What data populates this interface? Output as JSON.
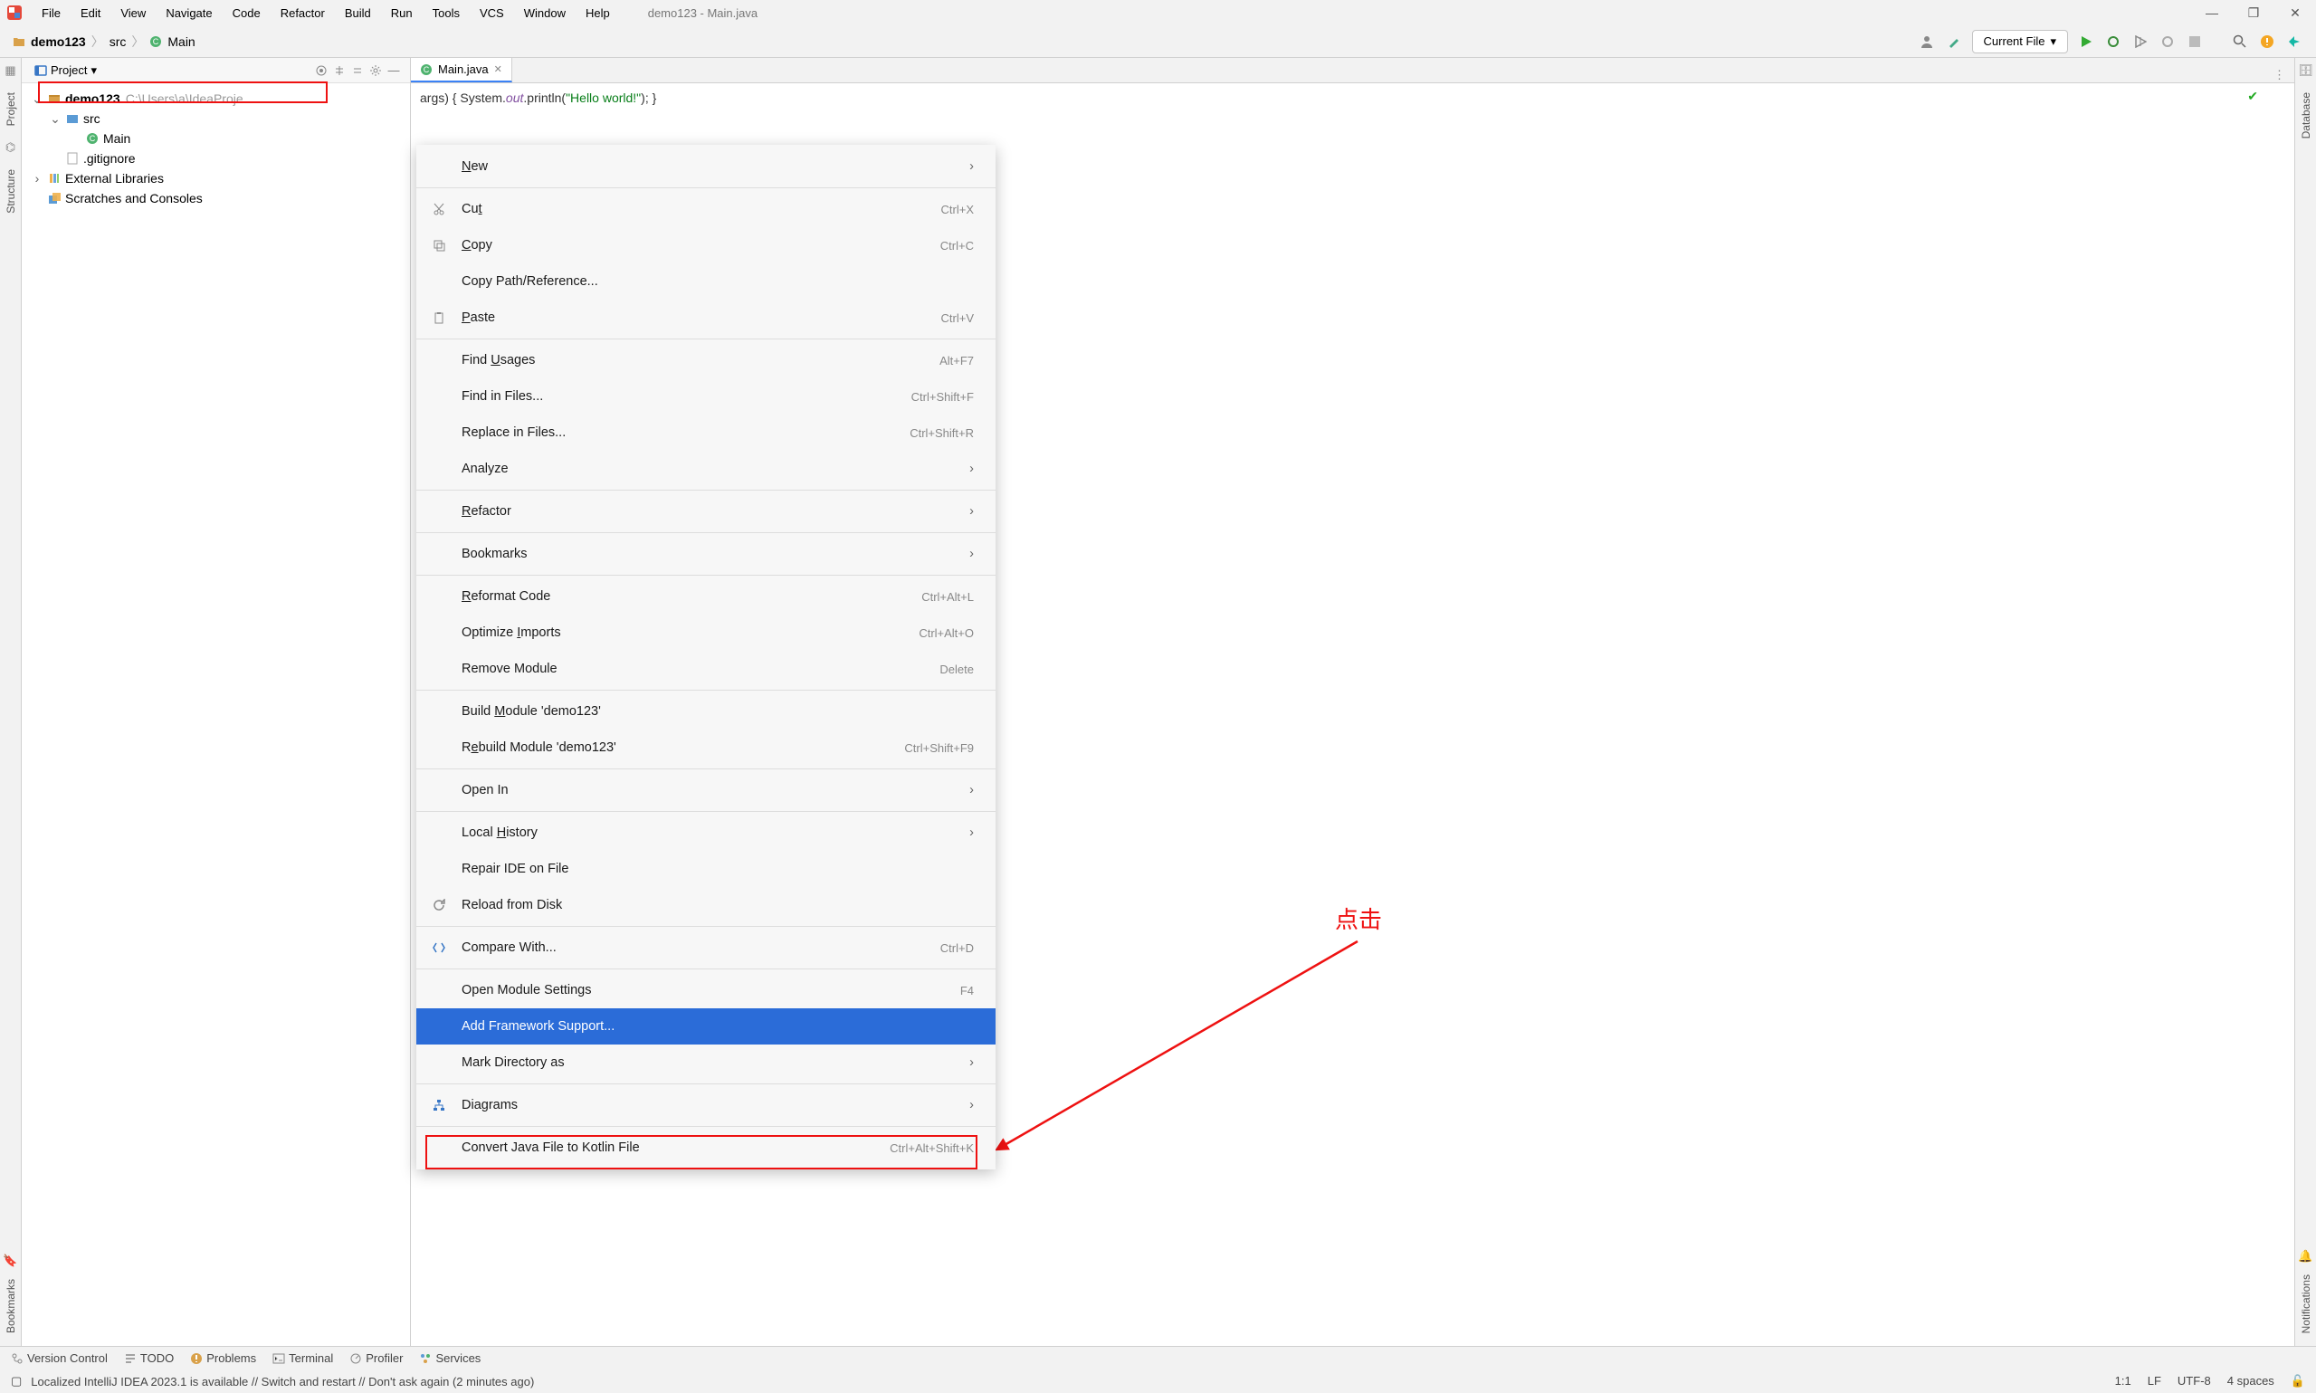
{
  "window": {
    "title": "demo123 - Main.java"
  },
  "menubar": [
    "File",
    "Edit",
    "View",
    "Navigate",
    "Code",
    "Refactor",
    "Build",
    "Run",
    "Tools",
    "VCS",
    "Window",
    "Help"
  ],
  "breadcrumb": {
    "project": "demo123",
    "folder": "src",
    "file": "Main"
  },
  "navbar": {
    "run_config": "Current File"
  },
  "project_panel": {
    "title": "Project",
    "root": {
      "name": "demo123",
      "path": "C:\\Users\\a\\IdeaProje"
    },
    "src": "src",
    "main": "Main",
    "gitignore": ".gitignore",
    "external": "External Libraries",
    "scratches": "Scratches and Consoles"
  },
  "tab": {
    "name": "Main.java"
  },
  "editor": {
    "code_visible": "args) { System.out.println(\"Hello world!\"); }"
  },
  "context_menu": [
    {
      "label": "New",
      "submenu": true,
      "u": 0
    },
    {
      "sep": true
    },
    {
      "label": "Cut",
      "shortcut": "Ctrl+X",
      "icon": "cut",
      "u": 2
    },
    {
      "label": "Copy",
      "shortcut": "Ctrl+C",
      "icon": "copy",
      "u": 0
    },
    {
      "label": "Copy Path/Reference..."
    },
    {
      "label": "Paste",
      "shortcut": "Ctrl+V",
      "icon": "paste",
      "u": 0
    },
    {
      "sep": true
    },
    {
      "label": "Find Usages",
      "shortcut": "Alt+F7",
      "u": 5
    },
    {
      "label": "Find in Files...",
      "shortcut": "Ctrl+Shift+F"
    },
    {
      "label": "Replace in Files...",
      "shortcut": "Ctrl+Shift+R"
    },
    {
      "label": "Analyze",
      "submenu": true
    },
    {
      "sep": true
    },
    {
      "label": "Refactor",
      "submenu": true,
      "u": 0
    },
    {
      "sep": true
    },
    {
      "label": "Bookmarks",
      "submenu": true
    },
    {
      "sep": true
    },
    {
      "label": "Reformat Code",
      "shortcut": "Ctrl+Alt+L",
      "u": 0
    },
    {
      "label": "Optimize Imports",
      "shortcut": "Ctrl+Alt+O",
      "u": 9
    },
    {
      "label": "Remove Module",
      "shortcut": "Delete"
    },
    {
      "sep": true
    },
    {
      "label": "Build Module 'demo123'",
      "u": 6
    },
    {
      "label": "Rebuild Module 'demo123'",
      "shortcut": "Ctrl+Shift+F9",
      "u": 1
    },
    {
      "sep": true
    },
    {
      "label": "Open In",
      "submenu": true
    },
    {
      "sep": true
    },
    {
      "label": "Local History",
      "submenu": true,
      "u": 6
    },
    {
      "label": "Repair IDE on File"
    },
    {
      "label": "Reload from Disk",
      "icon": "reload"
    },
    {
      "sep": true
    },
    {
      "label": "Compare With...",
      "shortcut": "Ctrl+D",
      "icon": "compare"
    },
    {
      "sep": true
    },
    {
      "label": "Open Module Settings",
      "shortcut": "F4"
    },
    {
      "label": "Add Framework Support...",
      "selected": true
    },
    {
      "label": "Mark Directory as",
      "submenu": true
    },
    {
      "sep": true
    },
    {
      "label": "Diagrams",
      "submenu": true,
      "icon": "diagram"
    },
    {
      "sep": true
    },
    {
      "label": "Convert Java File to Kotlin File",
      "shortcut": "Ctrl+Alt+Shift+K"
    }
  ],
  "annotation": {
    "label": "点击"
  },
  "gutters": {
    "project": "Project",
    "structure": "Structure",
    "bookmarks": "Bookmarks",
    "database": "Database",
    "notifications": "Notifications"
  },
  "bottom_tools": [
    "Version Control",
    "TODO",
    "Problems",
    "Terminal",
    "Profiler",
    "Services"
  ],
  "status": {
    "message": "Localized IntelliJ IDEA 2023.1 is available // Switch and restart // Don't ask again (2 minutes ago)",
    "cursor": "1:1",
    "le": "LF",
    "enc": "UTF-8",
    "indent": "4 spaces"
  }
}
